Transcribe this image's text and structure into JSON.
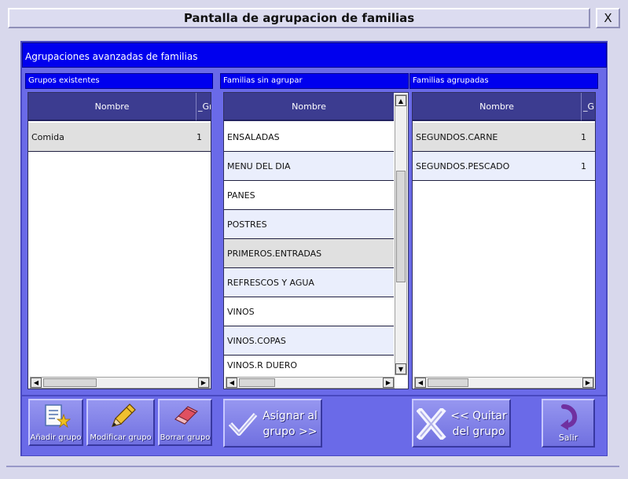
{
  "window": {
    "title": "Pantalla de agrupacion de familias",
    "close_label": "X"
  },
  "main": {
    "header": "Agrupaciones avanzadas de familias"
  },
  "groups": {
    "title": "Grupos existentes",
    "columns": [
      "Nombre",
      "_Gr"
    ],
    "rows": [
      {
        "name": "Comida",
        "count": "1"
      }
    ]
  },
  "ungrouped": {
    "title": "Familias sin agrupar",
    "columns": [
      "Nombre"
    ],
    "rows": [
      "ENSALADAS",
      "MENU DEL DIA",
      "PANES",
      "POSTRES",
      "PRIMEROS.ENTRADAS",
      "REFRESCOS Y AGUA",
      "VINOS",
      "VINOS.COPAS",
      "VINOS.R DUERO"
    ]
  },
  "grouped": {
    "title": "Familias agrupadas",
    "columns": [
      "Nombre",
      "_Gr"
    ],
    "rows": [
      {
        "name": "SEGUNDOS.CARNE",
        "count": "1"
      },
      {
        "name": "SEGUNDOS.PESCADO",
        "count": "1"
      }
    ]
  },
  "buttons": {
    "add_group": "Añadir grupo",
    "modify_group": "Modificar grupo",
    "delete_group": "Borrar grupo",
    "assign_line1": "Asignar al",
    "assign_line2": "grupo >>",
    "remove_line1": "<< Quitar",
    "remove_line2": "del grupo",
    "exit": "Salir"
  },
  "colors": {
    "panel": "#6a6ae8",
    "header_blue": "#0000ee",
    "grid_header": "#3c3c90",
    "row_alt": "#eaeefc",
    "row_selected": "#e0e0e0"
  }
}
